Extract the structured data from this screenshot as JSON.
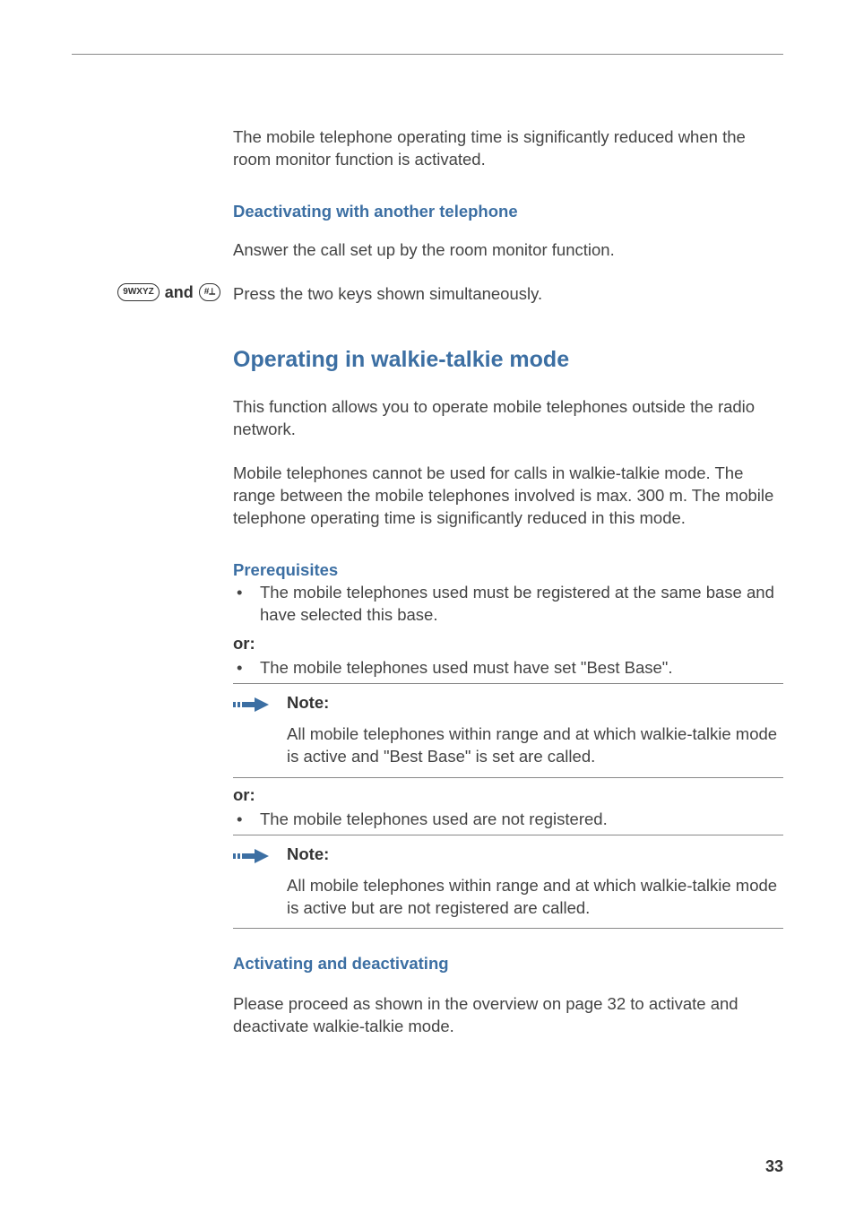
{
  "intro": {
    "p1": "The mobile telephone operating time is significantly reduced when the room monitor function is activated."
  },
  "deactivate": {
    "heading": "Deactivating with another telephone",
    "p1": "Answer the call set up by the room monitor function.",
    "keys_instruction": "Press the two keys shown simultaneously.",
    "key1": "9WXYZ",
    "and": "and",
    "key2": "#⟂"
  },
  "walkie": {
    "title": "Operating in walkie-talkie mode",
    "p1": "This function allows you to operate mobile telephones outside the radio network.",
    "p2": "Mobile telephones cannot be used for calls in walkie-talkie mode. The range between the mobile telephones involved is max. 300 m. The mobile telephone operating time is significantly reduced in this mode.",
    "prereq_heading": "Prerequisites",
    "prereq1": "The mobile telephones used must be registered at the same base and have selected this base.",
    "or1": "or:",
    "prereq2": "The mobile telephones used must have set \"Best Base\".",
    "note1_label": "Note:",
    "note1_text": "All mobile telephones within range and at which walkie-talkie mode is active and \"Best Base\" is set are called.",
    "or2": "or:",
    "prereq3": "The mobile telephones used are not registered.",
    "note2_label": "Note:",
    "note2_text": "All mobile telephones within range and at which walkie-talkie mode is active but are not registered are called.",
    "activate_heading": "Activating and deactivating",
    "activate_text": "Please proceed as shown in the overview on page 32 to activate and deactivate walkie-talkie mode."
  },
  "page_number": "33"
}
